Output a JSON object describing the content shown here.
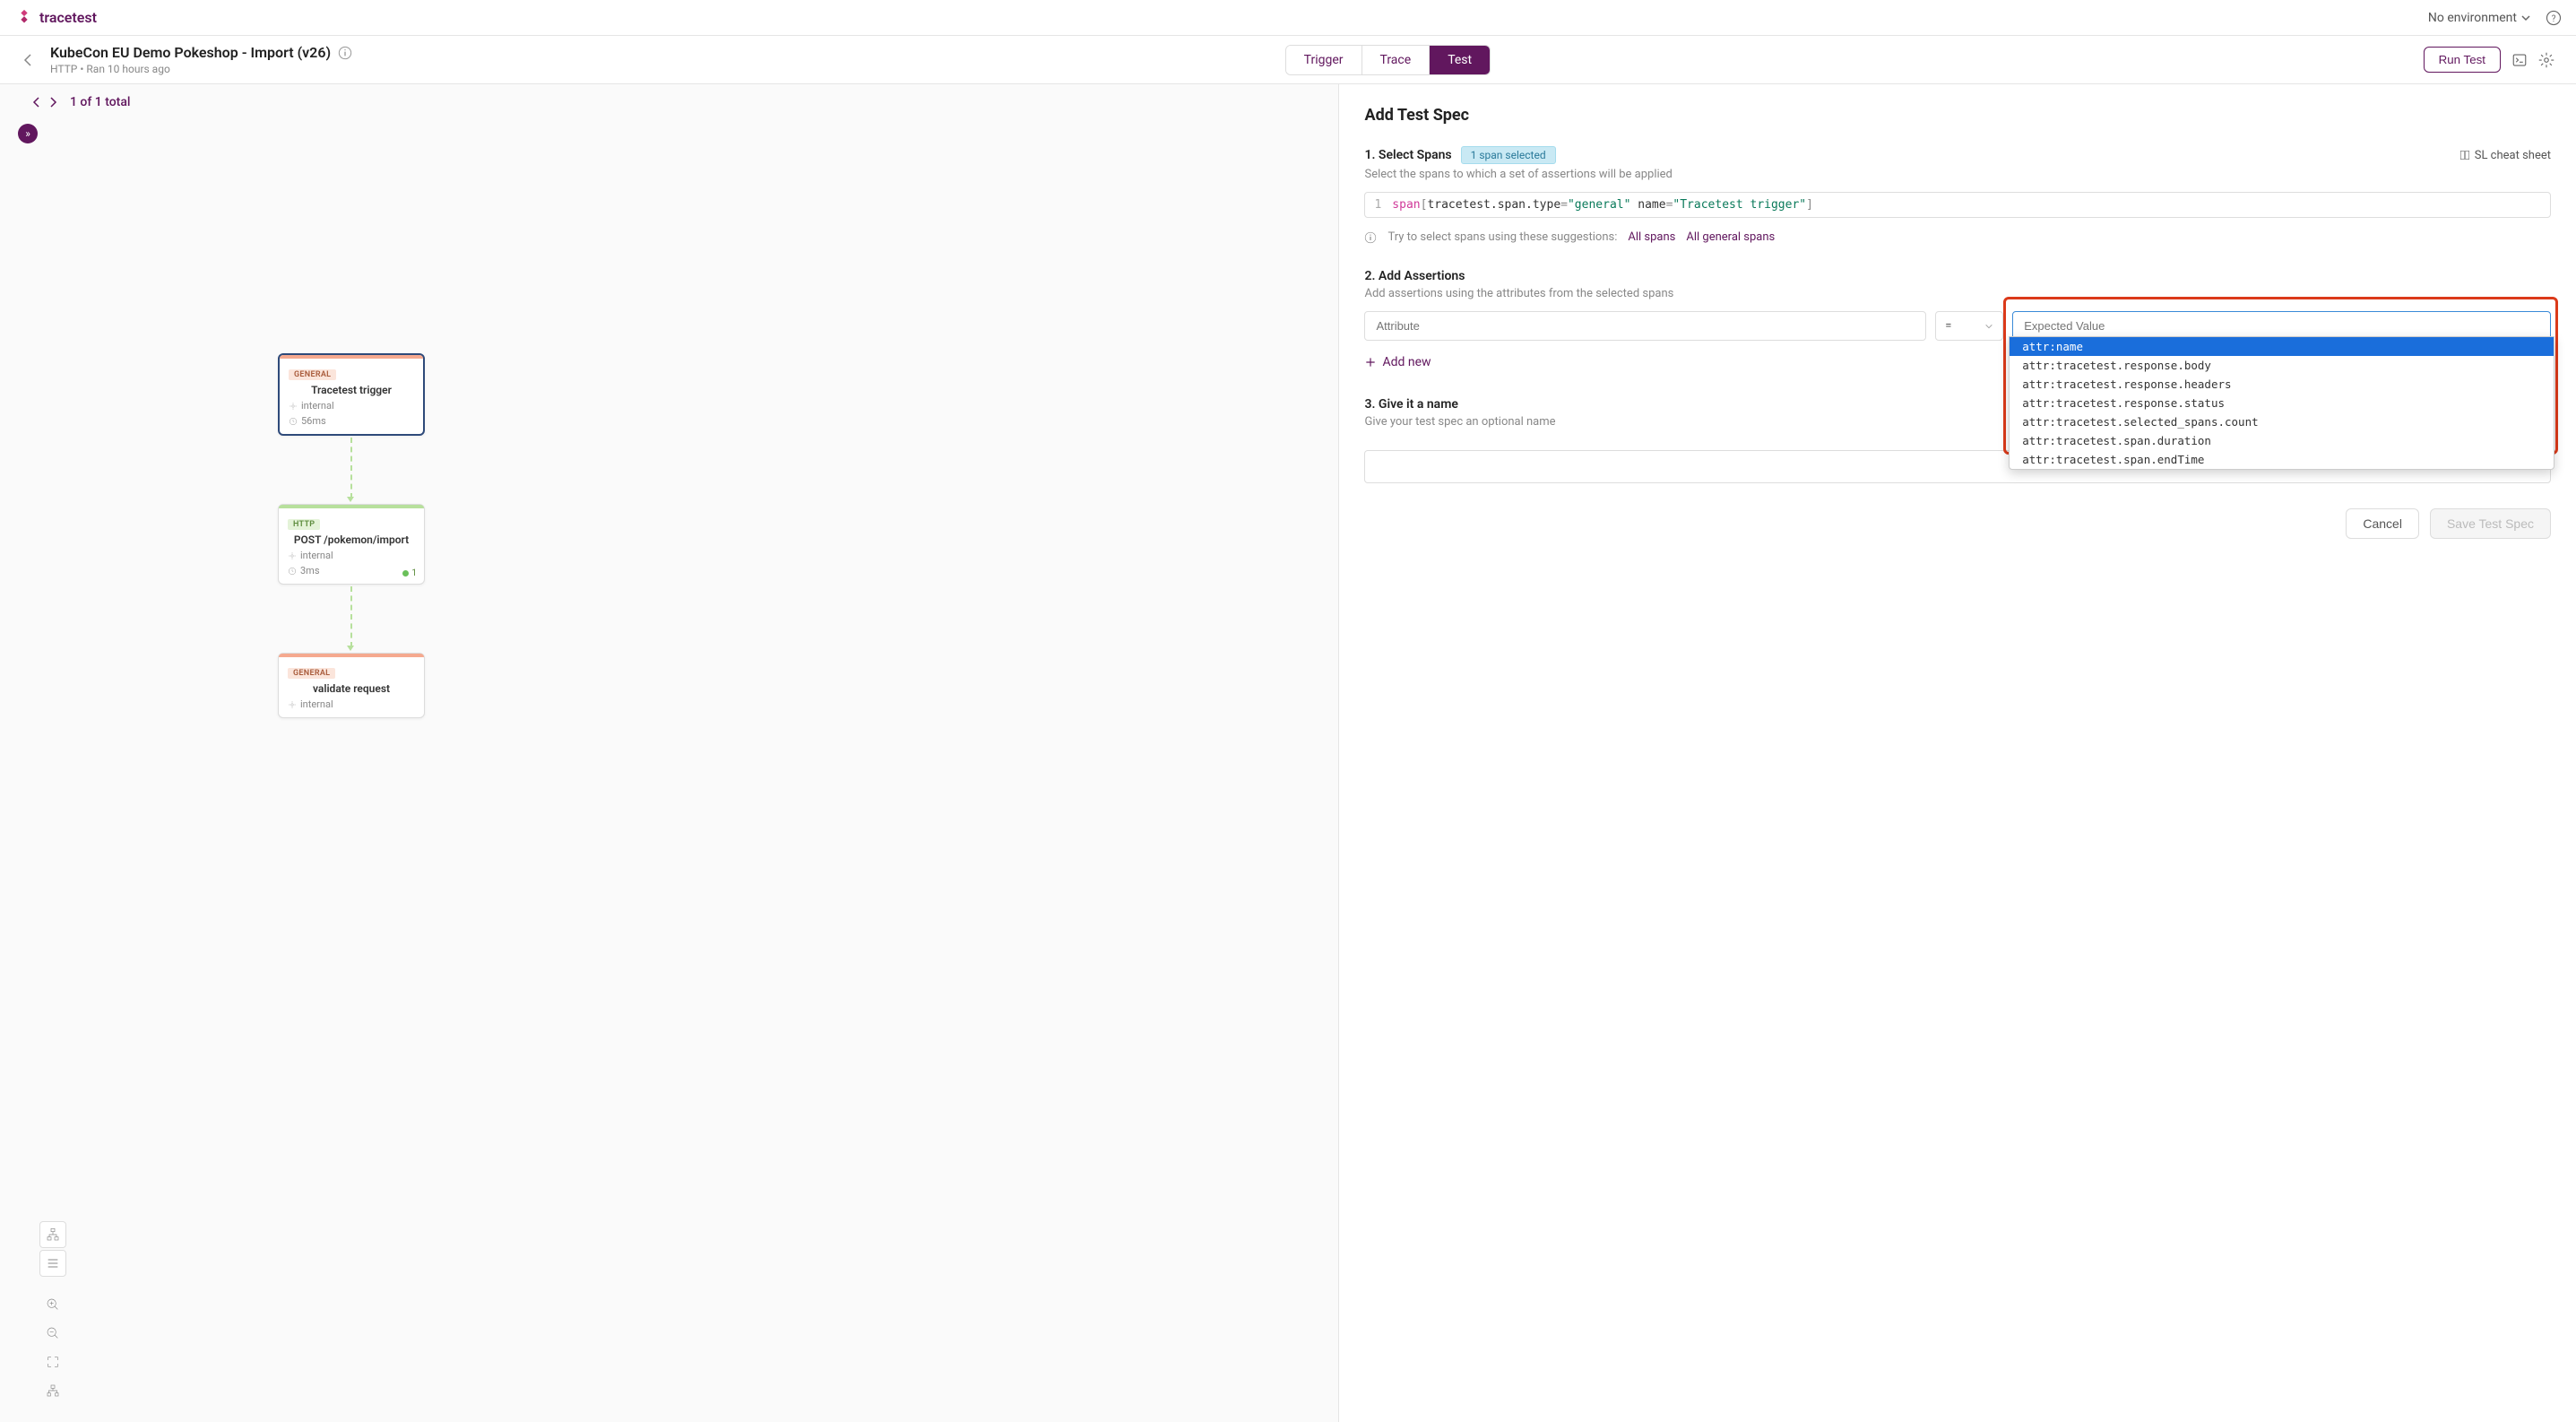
{
  "brand": "tracetest",
  "top": {
    "env": "No environment"
  },
  "header": {
    "title": "KubeCon EU Demo Pokeshop - Import (v26)",
    "protocol": "HTTP",
    "ran": "Ran 10 hours ago",
    "tabs": {
      "trigger": "Trigger",
      "trace": "Trace",
      "test": "Test"
    },
    "run_btn": "Run Test"
  },
  "pager": {
    "pos": "1 of 1 total"
  },
  "spans": {
    "s1": {
      "tag": "GENERAL",
      "name": "Tracetest trigger",
      "kind": "internal",
      "dur": "56ms"
    },
    "s2": {
      "tag": "HTTP",
      "name": "POST /pokemon/import",
      "kind": "internal",
      "dur": "3ms",
      "count": "1"
    },
    "s3": {
      "tag": "GENERAL",
      "name": "validate request",
      "kind": "internal"
    }
  },
  "panel": {
    "title": "Add Test Spec",
    "step1": {
      "label": "1. Select Spans",
      "badge": "1 span selected",
      "desc": "Select the spans to which a set of assertions will be applied",
      "cheat": "SL cheat sheet",
      "code_ln": "1",
      "code": {
        "kw": "span",
        "attr1": "tracetest.span.type",
        "val1": "\"general\"",
        "attr2": "name",
        "val2": "\"Tracetest trigger\""
      },
      "suggest_lead": "Try to select spans using these suggestions:",
      "suggest1": "All spans",
      "suggest2": "All general spans"
    },
    "step2": {
      "label": "2. Add Assertions",
      "desc": "Add assertions using the attributes from the selected spans",
      "attr_ph": "Attribute",
      "op": "=",
      "ev_ph": "Expected Value",
      "add_new": "Add new",
      "dropdown": [
        "attr:name",
        "attr:tracetest.response.body",
        "attr:tracetest.response.headers",
        "attr:tracetest.response.status",
        "attr:tracetest.selected_spans.count",
        "attr:tracetest.span.duration",
        "attr:tracetest.span.endTime"
      ]
    },
    "step3": {
      "label": "3. Give it a name",
      "desc": "Give your test spec an optional name"
    },
    "cancel": "Cancel",
    "save": "Save Test Spec"
  }
}
